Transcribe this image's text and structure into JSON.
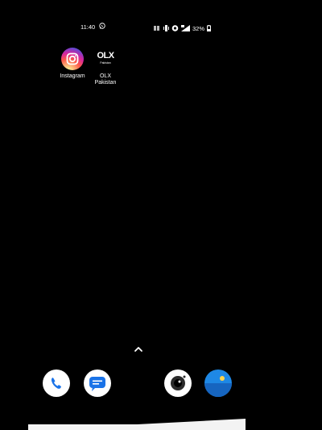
{
  "status_bar": {
    "time": "11:40",
    "battery": "32%",
    "icons": [
      "whatsapp-icon",
      "signal-icon",
      "vibrate-icon",
      "wifi-icon",
      "cell-signal-icon",
      "battery-icon"
    ]
  },
  "apps": [
    {
      "label": "Instagram",
      "icon": "instagram-icon"
    },
    {
      "label": "OLX\nPakistan",
      "icon": "olx-pakistan-icon",
      "logo_text": "OLX",
      "logo_sub": "Pakistan"
    }
  ],
  "dock": [
    {
      "icon": "phone-icon"
    },
    {
      "icon": "messages-icon"
    },
    {
      "icon": "camera-icon"
    },
    {
      "icon": "gallery-icon"
    }
  ],
  "colors": {
    "background": "#000000",
    "gallery": "#1e88e5",
    "messages": "#1a73e8",
    "phone": "#1a73e8"
  }
}
